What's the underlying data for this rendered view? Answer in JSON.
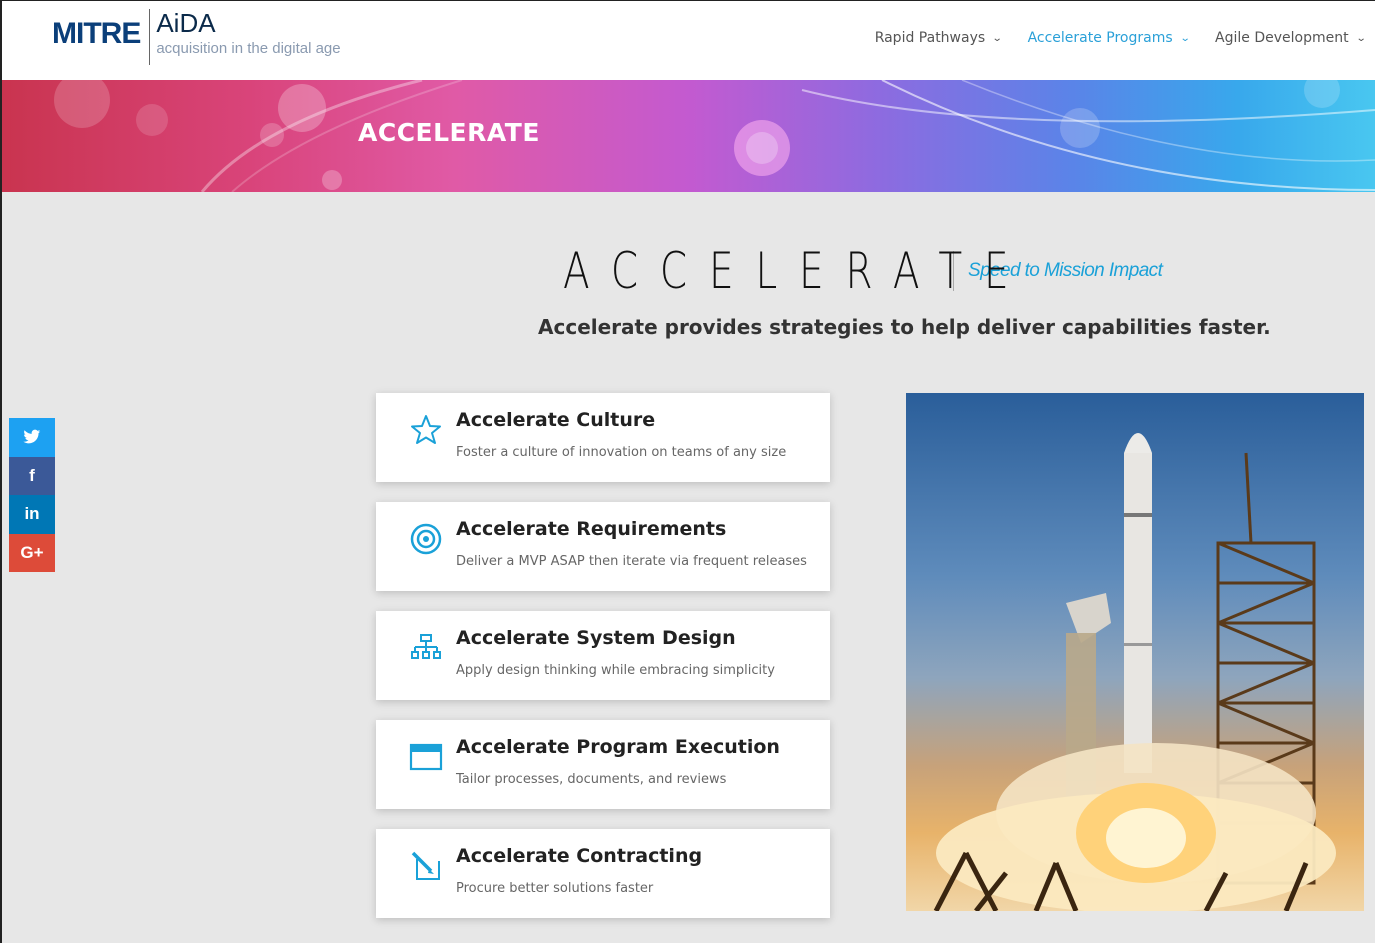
{
  "logo": {
    "brand": "MITRE",
    "product": "AiDA",
    "tagline": "acquisition in the digital age"
  },
  "nav": {
    "items": [
      {
        "label": "Rapid Pathways",
        "active": false
      },
      {
        "label": "Accelerate Programs",
        "active": true
      },
      {
        "label": "Agile Development",
        "active": false
      }
    ]
  },
  "banner": {
    "title": "ACCELERATE"
  },
  "hero": {
    "word": "ACCELERATE",
    "tagline": "Speed to Mission Impact",
    "subtitle": "Accelerate provides strategies to help deliver capabilities faster."
  },
  "cards": [
    {
      "title": "Accelerate Culture",
      "desc": "Foster a culture of innovation on teams of any size",
      "icon": "star-icon"
    },
    {
      "title": "Accelerate Requirements",
      "desc": "Deliver a MVP ASAP then iterate via frequent releases",
      "icon": "target-icon"
    },
    {
      "title": "Accelerate System Design",
      "desc": "Apply design thinking while embracing simplicity",
      "icon": "hierarchy-icon"
    },
    {
      "title": "Accelerate Program Execution",
      "desc": "Tailor processes, documents, and reviews",
      "icon": "window-icon"
    },
    {
      "title": "Accelerate Contracting",
      "desc": "Procure better solutions faster",
      "icon": "pen-icon"
    }
  ],
  "social": [
    {
      "name": "twitter",
      "glyph": "🐦",
      "color": "#1da1f2"
    },
    {
      "name": "facebook",
      "glyph": "f",
      "color": "#3b5998"
    },
    {
      "name": "linkedin",
      "glyph": "in",
      "color": "#0077b5"
    },
    {
      "name": "google-plus",
      "glyph": "G+",
      "color": "#dd4b39"
    }
  ],
  "colors": {
    "accent": "#1aa1d8",
    "brand": "#0b3f7a"
  }
}
